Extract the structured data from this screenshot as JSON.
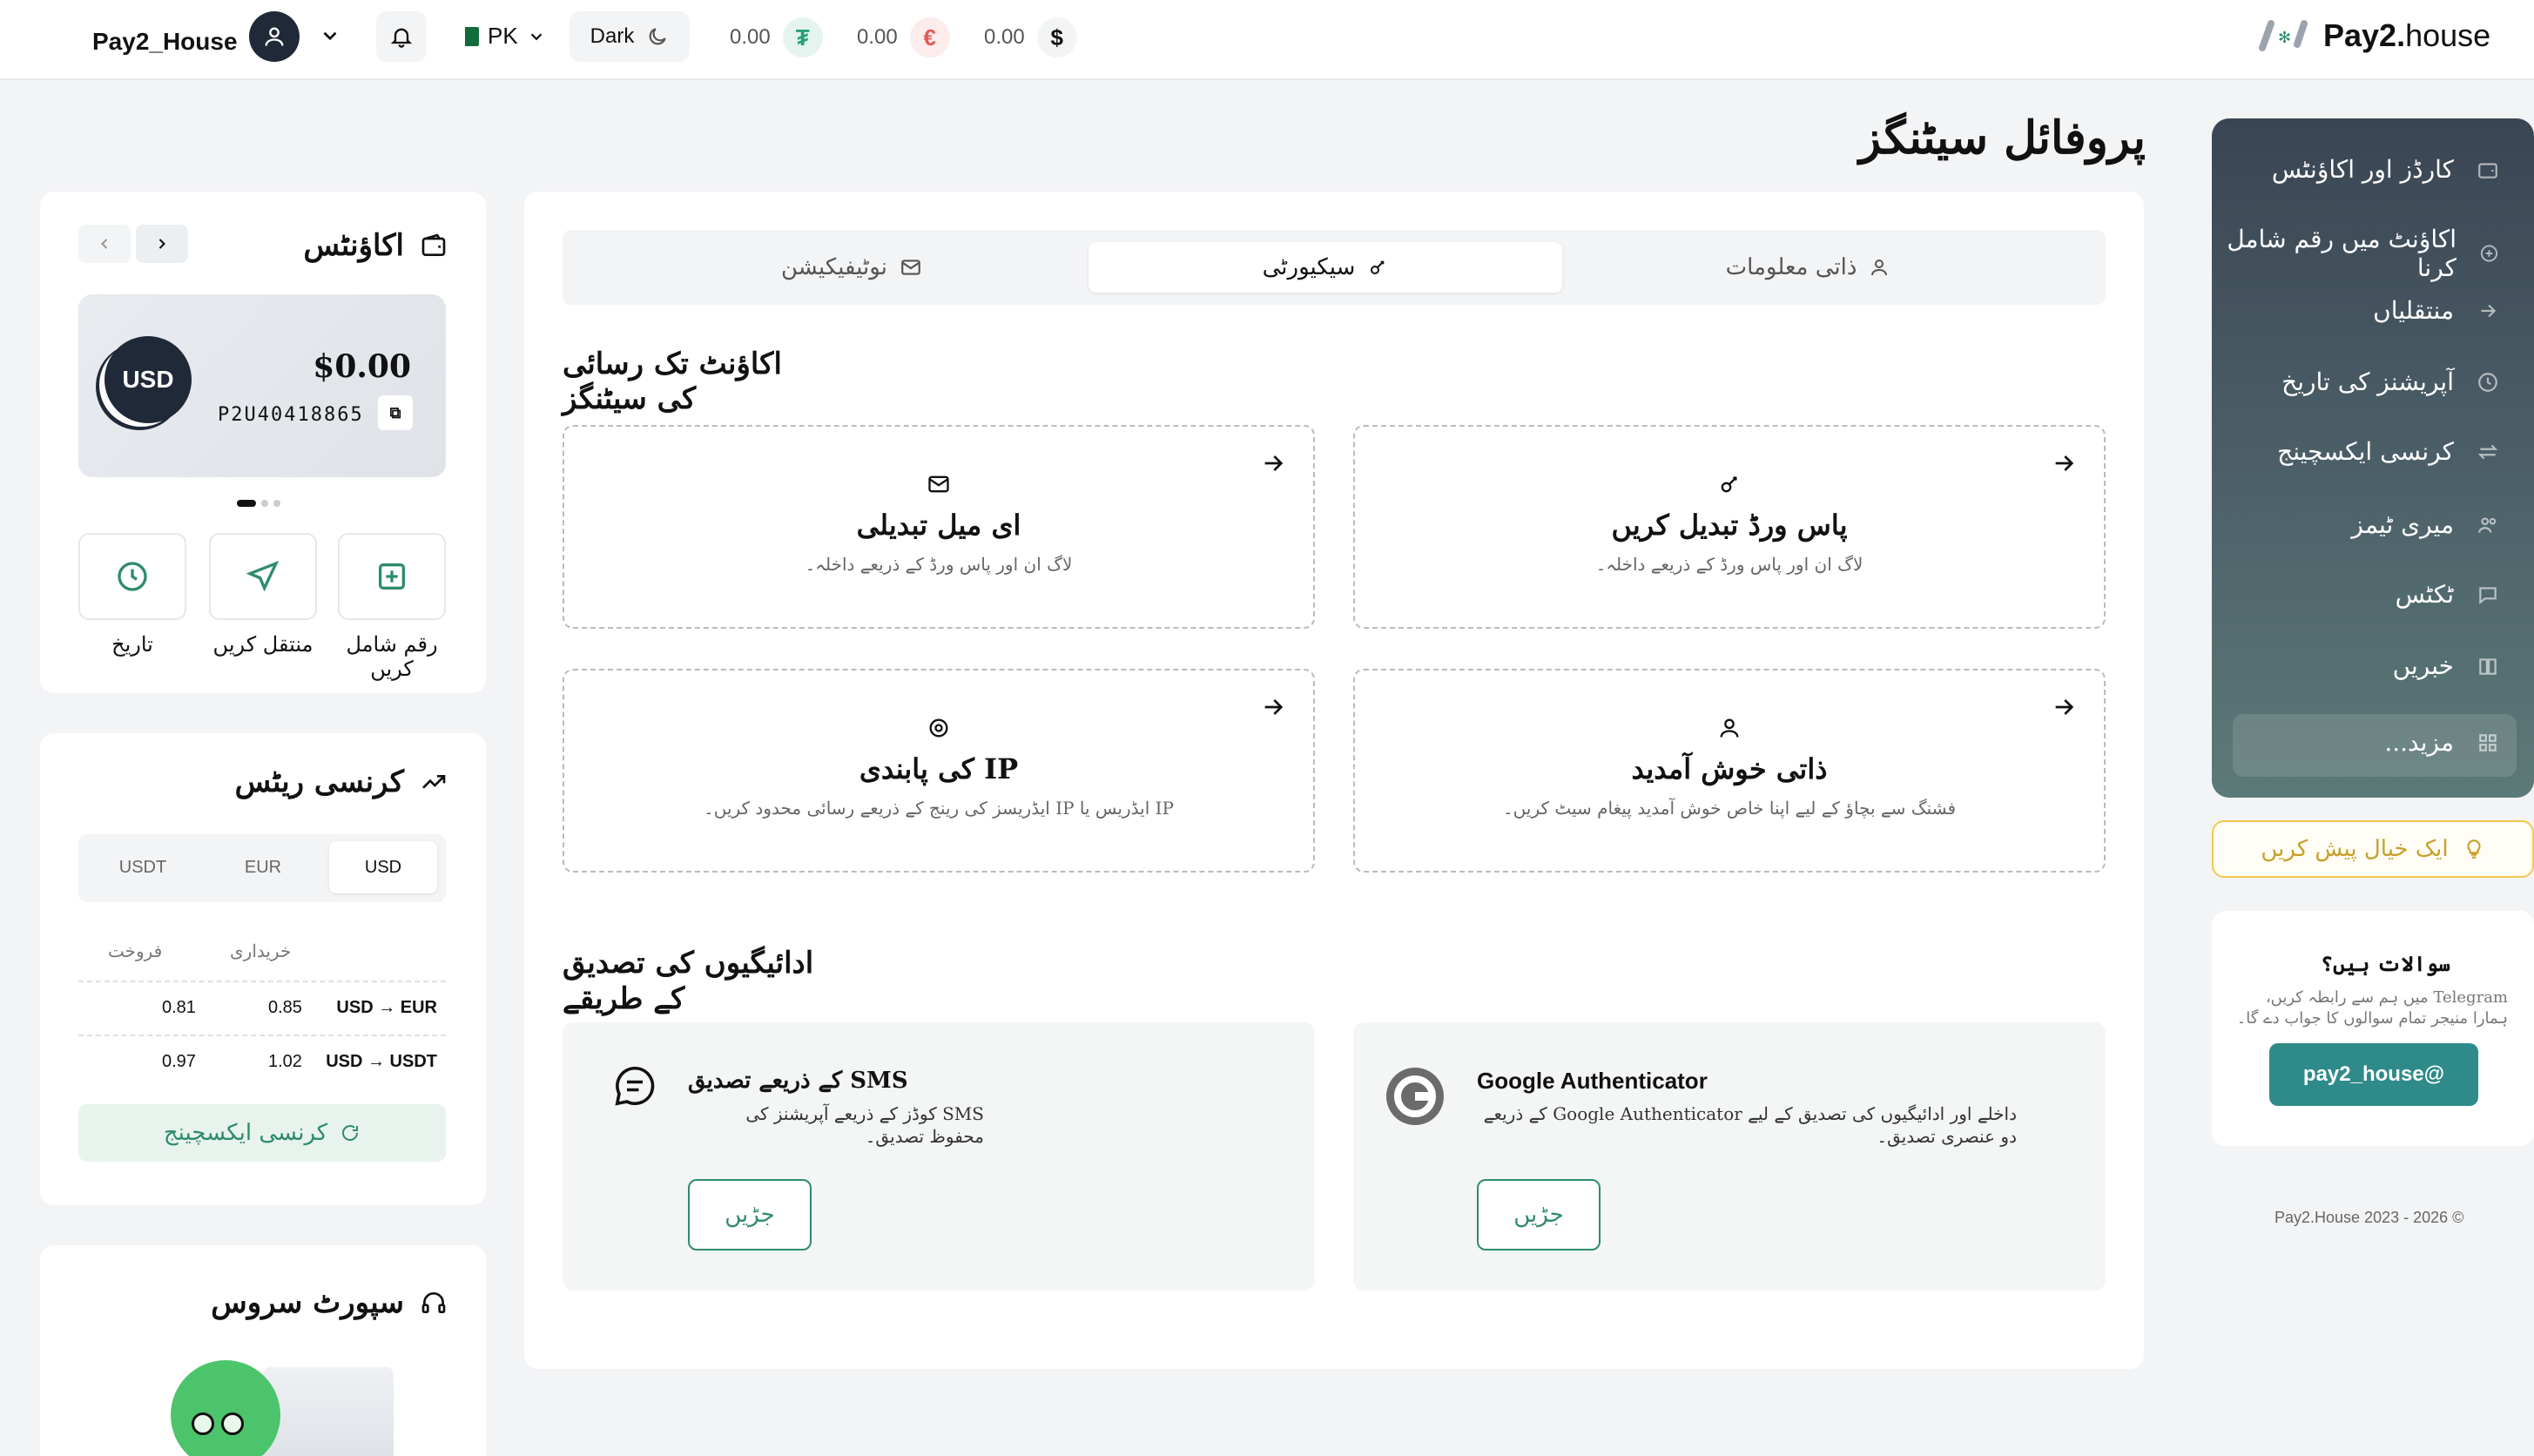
{
  "header": {
    "username": "Pay2_House",
    "country": "PK",
    "theme_label": "Dark",
    "balances": [
      {
        "value": "0.00",
        "currency": "tether-icon",
        "symbol": "₮",
        "color": "#26a17b"
      },
      {
        "value": "0.00",
        "currency": "euro-icon",
        "symbol": "€",
        "color": "#e05a5a"
      },
      {
        "value": "0.00",
        "currency": "dollar-icon",
        "symbol": "$",
        "color": "#111111"
      }
    ],
    "logo_bold": "Pay2.",
    "logo_light": "house"
  },
  "sidebar": {
    "items": [
      {
        "label": "کارڈز اور اکاؤنٹس",
        "icon": "wallet-icon"
      },
      {
        "label": "اکاؤنٹ میں رقم شامل کرنا",
        "icon": "plus-circle-icon"
      },
      {
        "label": "منتقلیاں",
        "icon": "arrow-right-icon"
      },
      {
        "label": "آپریشنز کی تاریخ",
        "icon": "clock-icon"
      },
      {
        "label": "کرنسی ایکسچینج",
        "icon": "exchange-icon"
      },
      {
        "label": "میری ٹیمز",
        "icon": "team-icon"
      },
      {
        "label": "ٹکٹس",
        "icon": "chat-icon"
      },
      {
        "label": "خبریں",
        "icon": "book-icon"
      },
      {
        "label": "مزید...",
        "icon": "grid-icon"
      }
    ],
    "idea_label": "ایک خیال پیش کریں",
    "help": {
      "title": "سوالات ہیں؟",
      "desc": "Telegram میں ہم سے رابطہ کریں، ہمارا منیجر تمام سوالوں کا جواب دے گا۔",
      "button": "pay2_house@"
    },
    "copyright": "Pay2.House 2023 - 2026 ©"
  },
  "page": {
    "title": "پروفائل سیٹنگز",
    "tabs": [
      {
        "label": "ذاتی معلومات",
        "icon": "user-icon"
      },
      {
        "label": "سیکیورٹی",
        "icon": "key-icon"
      },
      {
        "label": "نوٹیفیکیشن",
        "icon": "mail-icon"
      }
    ],
    "access_heading": "اکاؤنٹ تک رسائی کی سیٹنگز",
    "access_cards": [
      {
        "title": "پاس ورڈ تبدیل کریں",
        "desc": "لاگ ان اور پاس ورڈ کے ذریعے داخلہ۔",
        "icon": "key-icon"
      },
      {
        "title": "ای میل تبدیلی",
        "desc": "لاگ ان اور پاس ورڈ کے ذریعے داخلہ۔",
        "icon": "mail-icon"
      },
      {
        "title": "ذاتی خوش آمدید",
        "desc": "فشنگ سے بچاؤ کے لیے اپنا خاص خوش آمدید پیغام سیٹ کریں۔",
        "icon": "user-icon"
      },
      {
        "title": "IP کی پابندی",
        "desc": "IP ایڈریس یا IP ایڈریسز کی رینج کے ذریعے رسائی محدود کریں۔",
        "icon": "gear-icon"
      }
    ],
    "verify_heading": "ادائیگیوں کی تصدیق کے طریقے",
    "verify_cards": [
      {
        "title": "Google Authenticator",
        "desc": "داخلے اور ادائیگیوں کی تصدیق کے لیے Google Authenticator کے ذریعے دو عنصری تصدیق۔",
        "button": "جڑیں"
      },
      {
        "title": "SMS کے ذریعے تصدیق",
        "desc": "SMS کوڈز کے ذریعے آپریشنز کی محفوظ تصدیق۔",
        "button": "جڑیں"
      }
    ]
  },
  "accounts": {
    "title": "اکاؤنٹس",
    "currency": "USD",
    "balance": "$0.00",
    "account_id": "P2U40418865",
    "actions": [
      {
        "label": "رقم شامل کریں",
        "icon": "plus-square-icon"
      },
      {
        "label": "منتقل کریں",
        "icon": "send-icon"
      },
      {
        "label": "تاریخ",
        "icon": "clock-icon"
      }
    ]
  },
  "rates": {
    "title": "کرنسی ریٹس",
    "tabs": [
      "USD",
      "EUR",
      "USDT"
    ],
    "active_tab": "USD",
    "col_buy": "خریداری",
    "col_sell": "فروخت",
    "rows": [
      {
        "pair": "USD → EUR",
        "buy": "0.85",
        "sell": "0.81"
      },
      {
        "pair": "USD → USDT",
        "buy": "1.02",
        "sell": "0.97"
      }
    ],
    "exchange_label": "کرنسی ایکسچینج"
  },
  "support": {
    "title": "سپورٹ سروس"
  },
  "colors": {
    "accent": "#2e8b6e",
    "sidebar_top": "#3a4553",
    "sidebar_bottom": "#5c7a78"
  }
}
